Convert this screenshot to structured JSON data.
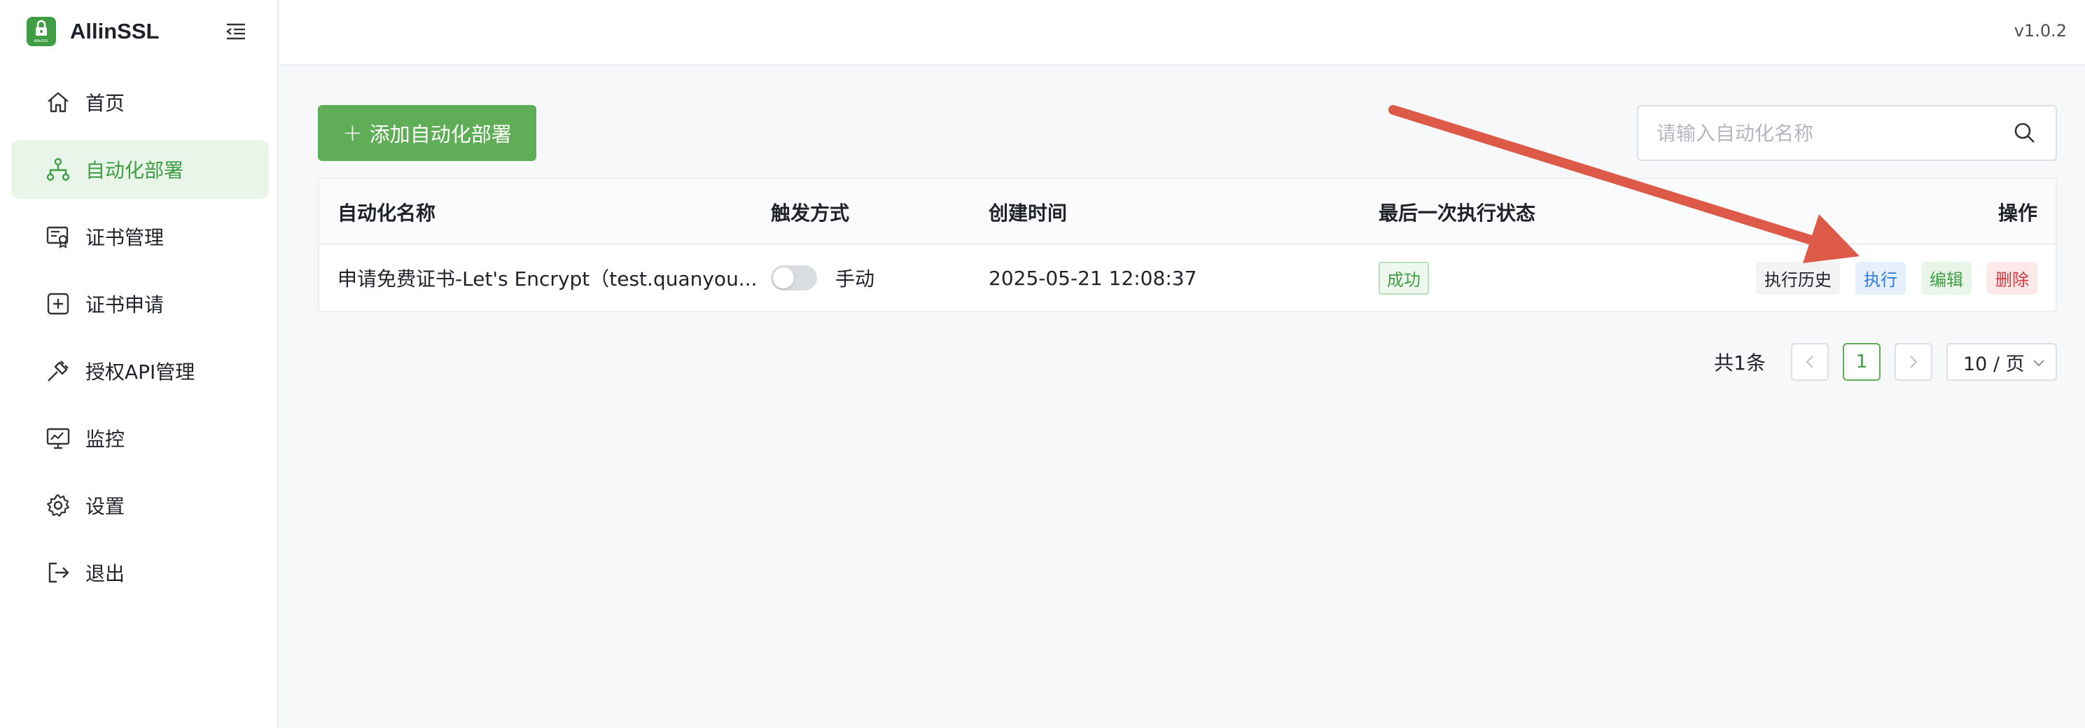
{
  "app": {
    "name": "AllinSSL",
    "version": "v1.0.2",
    "logo_text": "AllinSSL"
  },
  "sidebar": {
    "items": [
      {
        "label": "首页",
        "icon": "home-icon",
        "active": false
      },
      {
        "label": "自动化部署",
        "icon": "workflow-icon",
        "active": true
      },
      {
        "label": "证书管理",
        "icon": "certificate-icon",
        "active": false
      },
      {
        "label": "证书申请",
        "icon": "plus-square-icon",
        "active": false
      },
      {
        "label": "授权API管理",
        "icon": "plug-icon",
        "active": false
      },
      {
        "label": "监控",
        "icon": "monitor-icon",
        "active": false
      },
      {
        "label": "设置",
        "icon": "gear-icon",
        "active": false
      },
      {
        "label": "退出",
        "icon": "logout-icon",
        "active": false
      }
    ]
  },
  "toolbar": {
    "add_label": "添加自动化部署",
    "search_placeholder": "请输入自动化名称"
  },
  "table": {
    "headers": [
      "自动化名称",
      "触发方式",
      "创建时间",
      "最后一次执行状态",
      "操作"
    ],
    "rows": [
      {
        "name": "申请免费证书-Let's Encrypt（test.quanyou...",
        "trigger": "手动",
        "trigger_enabled": false,
        "created": "2025-05-21 12:08:37",
        "status": "成功",
        "actions": [
          "执行历史",
          "执行",
          "编辑",
          "删除"
        ]
      }
    ]
  },
  "pagination": {
    "total": "共1条",
    "current_page": "1",
    "page_size": "10 / 页"
  },
  "colors": {
    "brand": "#3f9e44",
    "annotation_arrow": "#dc5a47"
  }
}
